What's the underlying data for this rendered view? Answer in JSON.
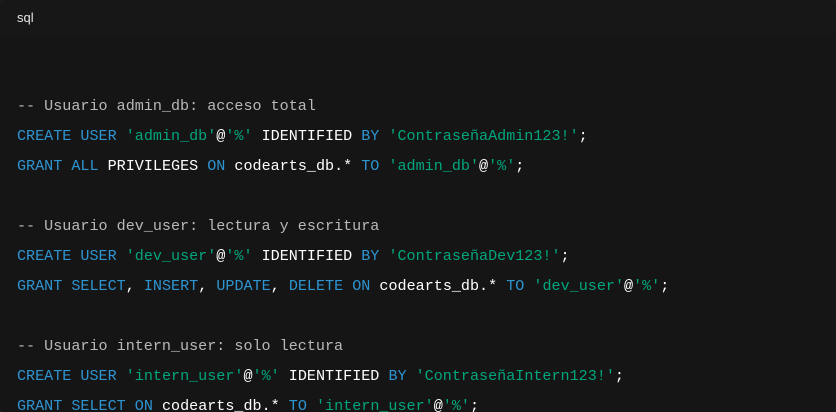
{
  "header": {
    "language": "sql"
  },
  "code": {
    "lines": [
      {
        "tokens": []
      },
      {
        "tokens": [
          {
            "t": "cm",
            "v": "-- Usuario admin_db: acceso total"
          }
        ]
      },
      {
        "tokens": [
          {
            "t": "kw",
            "v": "CREATE"
          },
          {
            "t": "id",
            "v": " "
          },
          {
            "t": "kw",
            "v": "USER"
          },
          {
            "t": "id",
            "v": " "
          },
          {
            "t": "str",
            "v": "'admin_db'"
          },
          {
            "t": "pun",
            "v": "@"
          },
          {
            "t": "str",
            "v": "'%'"
          },
          {
            "t": "id",
            "v": " IDENTIFIED "
          },
          {
            "t": "kw",
            "v": "BY"
          },
          {
            "t": "id",
            "v": " "
          },
          {
            "t": "str",
            "v": "'ContraseñaAdmin123!'"
          },
          {
            "t": "pun",
            "v": ";"
          }
        ]
      },
      {
        "tokens": [
          {
            "t": "kw",
            "v": "GRANT"
          },
          {
            "t": "id",
            "v": " "
          },
          {
            "t": "kw",
            "v": "ALL"
          },
          {
            "t": "id",
            "v": " PRIVILEGES "
          },
          {
            "t": "kw",
            "v": "ON"
          },
          {
            "t": "id",
            "v": " codearts_db.* "
          },
          {
            "t": "kw",
            "v": "TO"
          },
          {
            "t": "id",
            "v": " "
          },
          {
            "t": "str",
            "v": "'admin_db'"
          },
          {
            "t": "pun",
            "v": "@"
          },
          {
            "t": "str",
            "v": "'%'"
          },
          {
            "t": "pun",
            "v": ";"
          }
        ]
      },
      {
        "tokens": []
      },
      {
        "tokens": [
          {
            "t": "cm",
            "v": "-- Usuario dev_user: lectura y escritura"
          }
        ]
      },
      {
        "tokens": [
          {
            "t": "kw",
            "v": "CREATE"
          },
          {
            "t": "id",
            "v": " "
          },
          {
            "t": "kw",
            "v": "USER"
          },
          {
            "t": "id",
            "v": " "
          },
          {
            "t": "str",
            "v": "'dev_user'"
          },
          {
            "t": "pun",
            "v": "@"
          },
          {
            "t": "str",
            "v": "'%'"
          },
          {
            "t": "id",
            "v": " IDENTIFIED "
          },
          {
            "t": "kw",
            "v": "BY"
          },
          {
            "t": "id",
            "v": " "
          },
          {
            "t": "str",
            "v": "'ContraseñaDev123!'"
          },
          {
            "t": "pun",
            "v": ";"
          }
        ]
      },
      {
        "tokens": [
          {
            "t": "kw",
            "v": "GRANT"
          },
          {
            "t": "id",
            "v": " "
          },
          {
            "t": "kw",
            "v": "SELECT"
          },
          {
            "t": "pun",
            "v": ", "
          },
          {
            "t": "kw",
            "v": "INSERT"
          },
          {
            "t": "pun",
            "v": ", "
          },
          {
            "t": "kw",
            "v": "UPDATE"
          },
          {
            "t": "pun",
            "v": ", "
          },
          {
            "t": "kw",
            "v": "DELETE"
          },
          {
            "t": "id",
            "v": " "
          },
          {
            "t": "kw",
            "v": "ON"
          },
          {
            "t": "id",
            "v": " codearts_db.* "
          },
          {
            "t": "kw",
            "v": "TO"
          },
          {
            "t": "id",
            "v": " "
          },
          {
            "t": "str",
            "v": "'dev_user'"
          },
          {
            "t": "pun",
            "v": "@"
          },
          {
            "t": "str",
            "v": "'%'"
          },
          {
            "t": "pun",
            "v": ";"
          }
        ]
      },
      {
        "tokens": []
      },
      {
        "tokens": [
          {
            "t": "cm",
            "v": "-- Usuario intern_user: solo lectura"
          }
        ]
      },
      {
        "tokens": [
          {
            "t": "kw",
            "v": "CREATE"
          },
          {
            "t": "id",
            "v": " "
          },
          {
            "t": "kw",
            "v": "USER"
          },
          {
            "t": "id",
            "v": " "
          },
          {
            "t": "str",
            "v": "'intern_user'"
          },
          {
            "t": "pun",
            "v": "@"
          },
          {
            "t": "str",
            "v": "'%'"
          },
          {
            "t": "id",
            "v": " IDENTIFIED "
          },
          {
            "t": "kw",
            "v": "BY"
          },
          {
            "t": "id",
            "v": " "
          },
          {
            "t": "str",
            "v": "'ContraseñaIntern123!'"
          },
          {
            "t": "pun",
            "v": ";"
          }
        ]
      },
      {
        "tokens": [
          {
            "t": "kw",
            "v": "GRANT"
          },
          {
            "t": "id",
            "v": " "
          },
          {
            "t": "kw",
            "v": "SELECT"
          },
          {
            "t": "id",
            "v": " "
          },
          {
            "t": "kw",
            "v": "ON"
          },
          {
            "t": "id",
            "v": " codearts_db.* "
          },
          {
            "t": "kw",
            "v": "TO"
          },
          {
            "t": "id",
            "v": " "
          },
          {
            "t": "str",
            "v": "'intern_user'"
          },
          {
            "t": "pun",
            "v": "@"
          },
          {
            "t": "str",
            "v": "'%'"
          },
          {
            "t": "pun",
            "v": ";"
          }
        ]
      }
    ]
  },
  "colors": {
    "header_bg": "#171717",
    "body_bg": "#151515",
    "keyword": "#2e95d3",
    "string": "#00a67d",
    "comment": "#b9b9b9",
    "text": "#ffffff"
  }
}
